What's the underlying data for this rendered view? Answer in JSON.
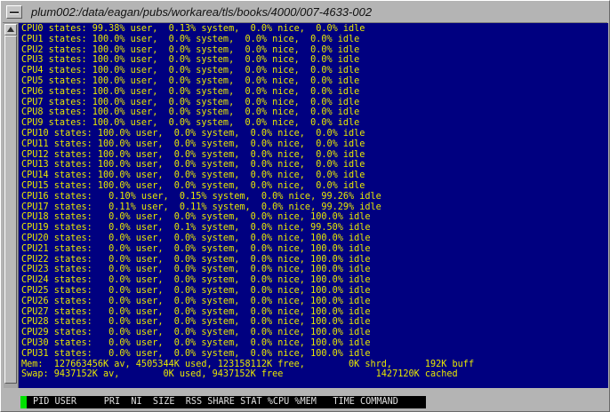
{
  "window": {
    "title": "plum002:/data/eagan/pubs/workarea/tls/books/4000/007-4633-002",
    "menu_icon": "window-menu-icon",
    "scroll_up_icon": "scroll-up-arrow-icon"
  },
  "colors": {
    "terminal_bg": "#000080",
    "terminal_text": "#e8e800",
    "cursor": "#00e000",
    "frame": "#b4b4b4"
  },
  "terminal": {
    "lines": [
      "CPU0 states: 99.38% user,  0.13% system,  0.0% nice,  0.0% idle",
      "CPU1 states: 100.0% user,  0.0% system,  0.0% nice,  0.0% idle",
      "CPU2 states: 100.0% user,  0.0% system,  0.0% nice,  0.0% idle",
      "CPU3 states: 100.0% user,  0.0% system,  0.0% nice,  0.0% idle",
      "CPU4 states: 100.0% user,  0.0% system,  0.0% nice,  0.0% idle",
      "CPU5 states: 100.0% user,  0.0% system,  0.0% nice,  0.0% idle",
      "CPU6 states: 100.0% user,  0.0% system,  0.0% nice,  0.0% idle",
      "CPU7 states: 100.0% user,  0.0% system,  0.0% nice,  0.0% idle",
      "CPU8 states: 100.0% user,  0.0% system,  0.0% nice,  0.0% idle",
      "CPU9 states: 100.0% user,  0.0% system,  0.0% nice,  0.0% idle",
      "CPU10 states: 100.0% user,  0.0% system,  0.0% nice,  0.0% idle",
      "CPU11 states: 100.0% user,  0.0% system,  0.0% nice,  0.0% idle",
      "CPU12 states: 100.0% user,  0.0% system,  0.0% nice,  0.0% idle",
      "CPU13 states: 100.0% user,  0.0% system,  0.0% nice,  0.0% idle",
      "CPU14 states: 100.0% user,  0.0% system,  0.0% nice,  0.0% idle",
      "CPU15 states: 100.0% user,  0.0% system,  0.0% nice,  0.0% idle",
      "CPU16 states:   0.10% user,  0.15% system,  0.0% nice, 99.26% idle",
      "CPU17 states:   0.11% user,  0.11% system,  0.0% nice, 99.29% idle",
      "CPU18 states:   0.0% user,  0.0% system,  0.0% nice, 100.0% idle",
      "CPU19 states:   0.0% user,  0.1% system,  0.0% nice, 99.50% idle",
      "CPU20 states:   0.0% user,  0.0% system,  0.0% nice, 100.0% idle",
      "CPU21 states:   0.0% user,  0.0% system,  0.0% nice, 100.0% idle",
      "CPU22 states:   0.0% user,  0.0% system,  0.0% nice, 100.0% idle",
      "CPU23 states:   0.0% user,  0.0% system,  0.0% nice, 100.0% idle",
      "CPU24 states:   0.0% user,  0.0% system,  0.0% nice, 100.0% idle",
      "CPU25 states:   0.0% user,  0.0% system,  0.0% nice, 100.0% idle",
      "CPU26 states:   0.0% user,  0.0% system,  0.0% nice, 100.0% idle",
      "CPU27 states:   0.0% user,  0.0% system,  0.0% nice, 100.0% idle",
      "CPU28 states:   0.0% user,  0.0% system,  0.0% nice, 100.0% idle",
      "CPU29 states:   0.0% user,  0.0% system,  0.0% nice, 100.0% idle",
      "CPU30 states:   0.0% user,  0.0% system,  0.0% nice, 100.0% idle",
      "CPU31 states:   0.0% user,  0.0% system,  0.0% nice, 100.0% idle",
      "Mem:  127663456K av, 4505344K used, 123158112K free,        0K shrd,      192K buff",
      "Swap: 9437152K av,        0K used, 9437152K free                 1427120K cached"
    ]
  },
  "prompt": {
    "header_text": "PID USER     PRI  NI  SIZE  RSS SHARE STAT %CPU %MEM   TIME COMMAND"
  }
}
